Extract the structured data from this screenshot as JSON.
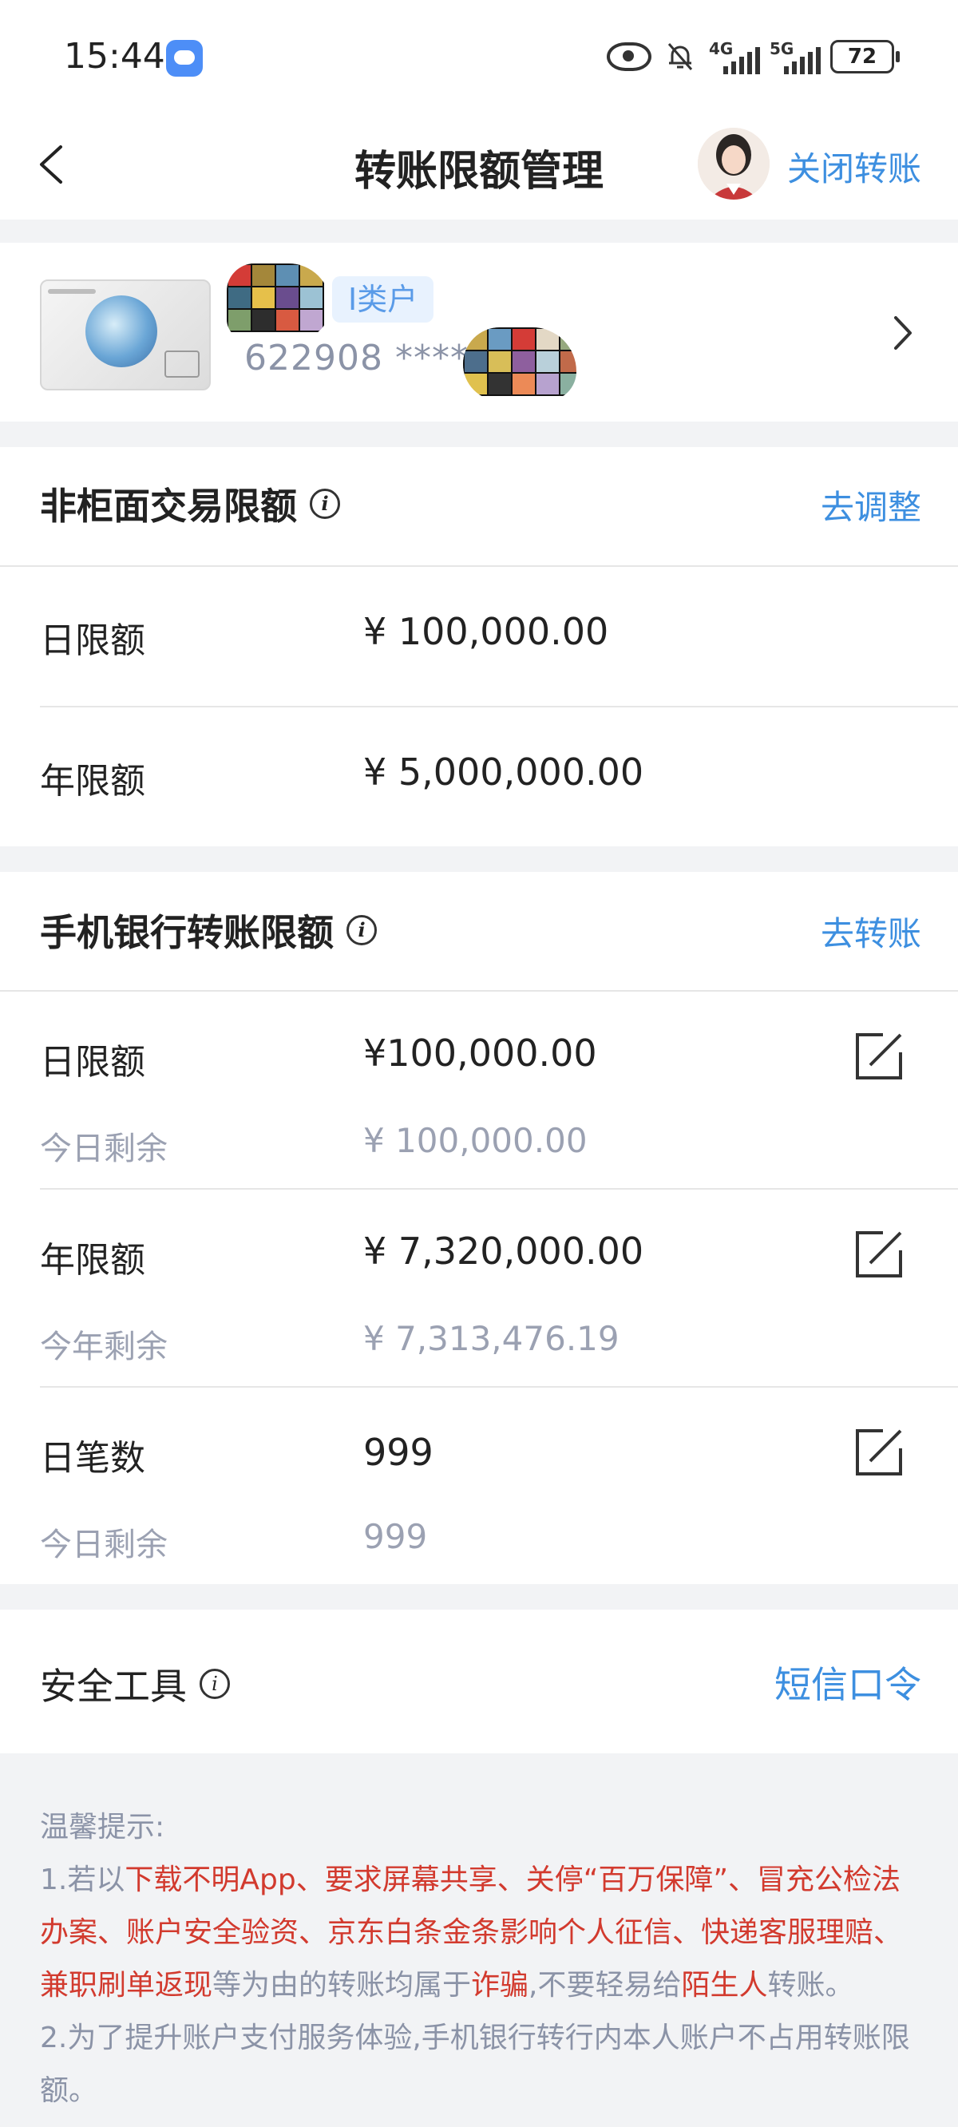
{
  "status_bar": {
    "time": "15:44",
    "net1": "4G",
    "net2": "5G",
    "battery": "72"
  },
  "nav": {
    "title": "转账限额管理",
    "close_transfer": "关闭转账"
  },
  "card": {
    "class_tag": "I类户",
    "number": "622908 ****"
  },
  "non_counter": {
    "title": "非柜面交易限额",
    "action": "去调整",
    "rows": [
      {
        "label": "日限额",
        "value": "¥ 100,000.00"
      },
      {
        "label": "年限额",
        "value": "¥ 5,000,000.00"
      }
    ]
  },
  "mobile": {
    "title": "手机银行转账限额",
    "action": "去转账",
    "rows": [
      {
        "label": "日限额",
        "value": "¥100,000.00",
        "sub_label": "今日剩余",
        "sub_value": "¥ 100,000.00"
      },
      {
        "label": "年限额",
        "value": "¥ 7,320,000.00",
        "sub_label": "今年剩余",
        "sub_value": "¥ 7,313,476.19"
      },
      {
        "label": "日笔数",
        "value": "999",
        "sub_label": "今日剩余",
        "sub_value": "999"
      }
    ]
  },
  "security": {
    "title": "安全工具",
    "action": "短信口令"
  },
  "tips": {
    "heading": "温馨提示:",
    "l1_a": "1.若以",
    "l1_b": "下载不明App、要求屏幕共享、关停“百万保障”、冒充公检法办案、账户安全验资、京东白条金条影响个人征信、快递客服理赔、兼职刷单返现",
    "l1_c": "等为由的转账均属于",
    "l1_d": "诈骗",
    "l1_e": ",不要轻易给",
    "l1_f": "陌生人",
    "l1_g": "转账。",
    "l2": "2.为了提升账户支付服务体验,手机银行转行内本人账户不占用转账限额。"
  },
  "colors": {
    "accent": "#3d8fe0",
    "warning": "#d23a2e",
    "muted": "#9ba1b2"
  }
}
